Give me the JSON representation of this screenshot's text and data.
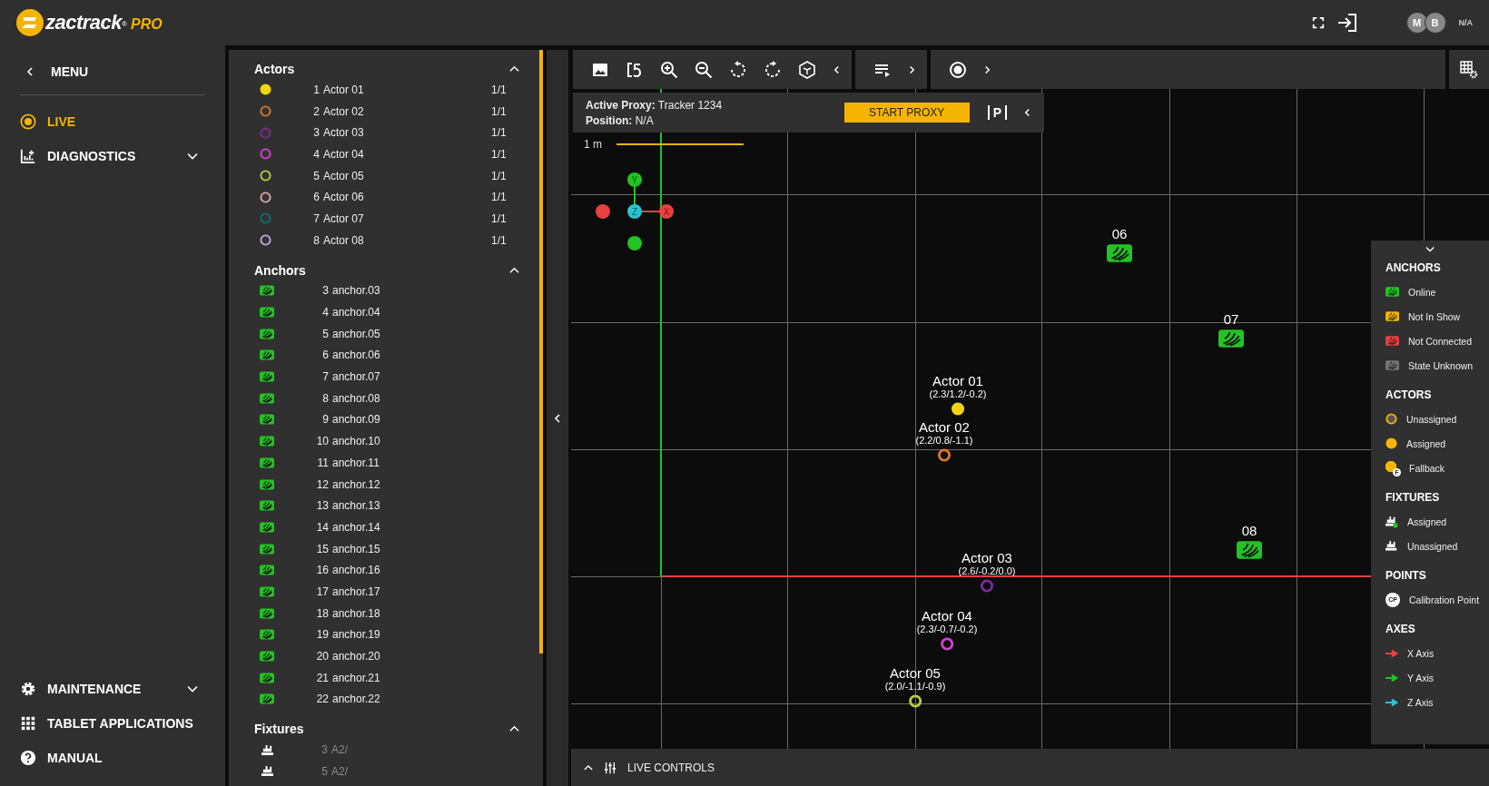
{
  "header": {
    "logo": "zactrack",
    "logo_mark": "®",
    "logo_badge": "PRO",
    "user_initials": [
      "M",
      "B"
    ],
    "user_status": "N/A"
  },
  "nav": {
    "back_label": "MENU",
    "items": [
      {
        "label": "LIVE",
        "kind": "live",
        "selected": true,
        "expandable": false
      },
      {
        "label": "DIAGNOSTICS",
        "kind": "diagnostics",
        "selected": false,
        "expandable": true
      }
    ],
    "bottom_items": [
      {
        "label": "MAINTENANCE",
        "kind": "maintenance",
        "selected": false,
        "expandable": true
      },
      {
        "label": "TABLET APPLICATIONS",
        "kind": "apps",
        "selected": false,
        "expandable": false
      },
      {
        "label": "MANUAL",
        "kind": "manual",
        "selected": false,
        "expandable": false
      }
    ]
  },
  "actors_panel": {
    "title": "Actors",
    "expanded": true,
    "items": [
      {
        "number": "1",
        "name": "Actor 01",
        "count": "1/1",
        "color": "#f2d40c",
        "assigned": true
      },
      {
        "number": "2",
        "name": "Actor 02",
        "count": "1/1",
        "color": "#d9782f",
        "assigned": false
      },
      {
        "number": "3",
        "name": "Actor 03",
        "count": "1/1",
        "color": "#7a2a99",
        "assigned": false
      },
      {
        "number": "4",
        "name": "Actor 04",
        "count": "1/1",
        "color": "#d63fd6",
        "assigned": false
      },
      {
        "number": "5",
        "name": "Actor 05",
        "count": "1/1",
        "color": "#b5d13a",
        "assigned": false
      },
      {
        "number": "6",
        "name": "Actor 06",
        "count": "1/1",
        "color": "#d9a8a8",
        "assigned": false
      },
      {
        "number": "7",
        "name": "Actor 07",
        "count": "1/1",
        "color": "#0f6e6e",
        "assigned": false
      },
      {
        "number": "8",
        "name": "Actor 08",
        "count": "1/1",
        "color": "#c8a8dd",
        "assigned": false
      }
    ]
  },
  "anchors_panel": {
    "title": "Anchors",
    "expanded": true,
    "items": [
      {
        "number": "3",
        "name": "anchor.03",
        "color": "#22c322"
      },
      {
        "number": "4",
        "name": "anchor.04",
        "color": "#22c322"
      },
      {
        "number": "5",
        "name": "anchor.05",
        "color": "#22c322"
      },
      {
        "number": "6",
        "name": "anchor.06",
        "color": "#22c322"
      },
      {
        "number": "7",
        "name": "anchor.07",
        "color": "#22c322"
      },
      {
        "number": "8",
        "name": "anchor.08",
        "color": "#22c322"
      },
      {
        "number": "9",
        "name": "anchor.09",
        "color": "#22c322"
      },
      {
        "number": "10",
        "name": "anchor.10",
        "color": "#22c322"
      },
      {
        "number": "11",
        "name": "anchor.11",
        "color": "#22c322"
      },
      {
        "number": "12",
        "name": "anchor.12",
        "color": "#22c322"
      },
      {
        "number": "13",
        "name": "anchor.13",
        "color": "#22c322"
      },
      {
        "number": "14",
        "name": "anchor.14",
        "color": "#22c322"
      },
      {
        "number": "15",
        "name": "anchor.15",
        "color": "#22c322"
      },
      {
        "number": "16",
        "name": "anchor.16",
        "color": "#22c322"
      },
      {
        "number": "17",
        "name": "anchor.17",
        "color": "#22c322"
      },
      {
        "number": "18",
        "name": "anchor.18",
        "color": "#22c322"
      },
      {
        "number": "19",
        "name": "anchor.19",
        "color": "#22c322"
      },
      {
        "number": "20",
        "name": "anchor.20",
        "color": "#22c322"
      },
      {
        "number": "21",
        "name": "anchor.21",
        "color": "#22c322"
      },
      {
        "number": "22",
        "name": "anchor.22",
        "color": "#22c322"
      }
    ]
  },
  "fixtures_panel": {
    "title": "Fixtures",
    "expanded": true,
    "items": [
      {
        "number": "3",
        "name": "A2/"
      },
      {
        "number": "5",
        "name": "A2/"
      }
    ]
  },
  "proxy": {
    "active_label": "Active Proxy:",
    "active_value": "Tracker 1234",
    "position_label": "Position:",
    "position_value": "N/A",
    "button": "START PROXY",
    "key": "P"
  },
  "canvas": {
    "scale_label": "1 m",
    "axis_labels": {
      "x": "X",
      "y": "Y",
      "z": "Z"
    },
    "anchors": [
      {
        "label": "06",
        "color": "#22c322"
      },
      {
        "label": "07",
        "color": "#22c322"
      },
      {
        "label": "08",
        "color": "#22c322"
      }
    ],
    "actors": [
      {
        "name": "Actor 01",
        "position": "(2.3/1.2/-0.2)",
        "color": "#f2d40c",
        "assigned": true
      },
      {
        "name": "Actor 02",
        "position": "(2.2/0.8/-1.1)",
        "color": "#d9782f",
        "assigned": false
      },
      {
        "name": "Actor 03",
        "position": "(2.6/-0.2/0.0)",
        "color": "#7a2a99",
        "assigned": false
      },
      {
        "name": "Actor 04",
        "position": "(2.3/-0.7/-0.2)",
        "color": "#d63fd6",
        "assigned": false
      },
      {
        "name": "Actor 05",
        "position": "(2.0/-1.1/-0.9)",
        "color": "#b5d13a",
        "assigned": false
      }
    ]
  },
  "legend": {
    "expanded": true,
    "sections": [
      {
        "title": "ANCHORS",
        "items": [
          {
            "kind": "anchor",
            "color": "#22c322",
            "label": "Online"
          },
          {
            "kind": "anchor",
            "color": "#f0b400",
            "label": "Not In Show"
          },
          {
            "kind": "anchor",
            "color": "#e84040",
            "label": "Not Connected"
          },
          {
            "kind": "anchor",
            "color": "#777777",
            "label": "State Unknown"
          }
        ]
      },
      {
        "title": "ACTORS",
        "items": [
          {
            "kind": "actor-unassigned",
            "label": "Unassigned"
          },
          {
            "kind": "actor-assigned",
            "label": "Assigned"
          },
          {
            "kind": "actor-fallback",
            "badge": "F",
            "label": "Fallback"
          }
        ]
      },
      {
        "title": "FIXTURES",
        "items": [
          {
            "kind": "fixture-assigned",
            "label": "Assigned"
          },
          {
            "kind": "fixture-unassigned",
            "label": "Unassigned"
          }
        ]
      },
      {
        "title": "POINTS",
        "items": [
          {
            "kind": "calibration",
            "badge": "CP",
            "label": "Calibration Point"
          }
        ]
      },
      {
        "title": "AXES",
        "items": [
          {
            "kind": "axis",
            "color": "#e84040",
            "label": "X Axis"
          },
          {
            "kind": "axis",
            "color": "#22c322",
            "label": "Y Axis"
          },
          {
            "kind": "axis",
            "color": "#2ac4d0",
            "label": "Z Axis"
          }
        ]
      }
    ]
  },
  "live_controls": {
    "label": "LIVE CONTROLS",
    "expanded": false
  }
}
